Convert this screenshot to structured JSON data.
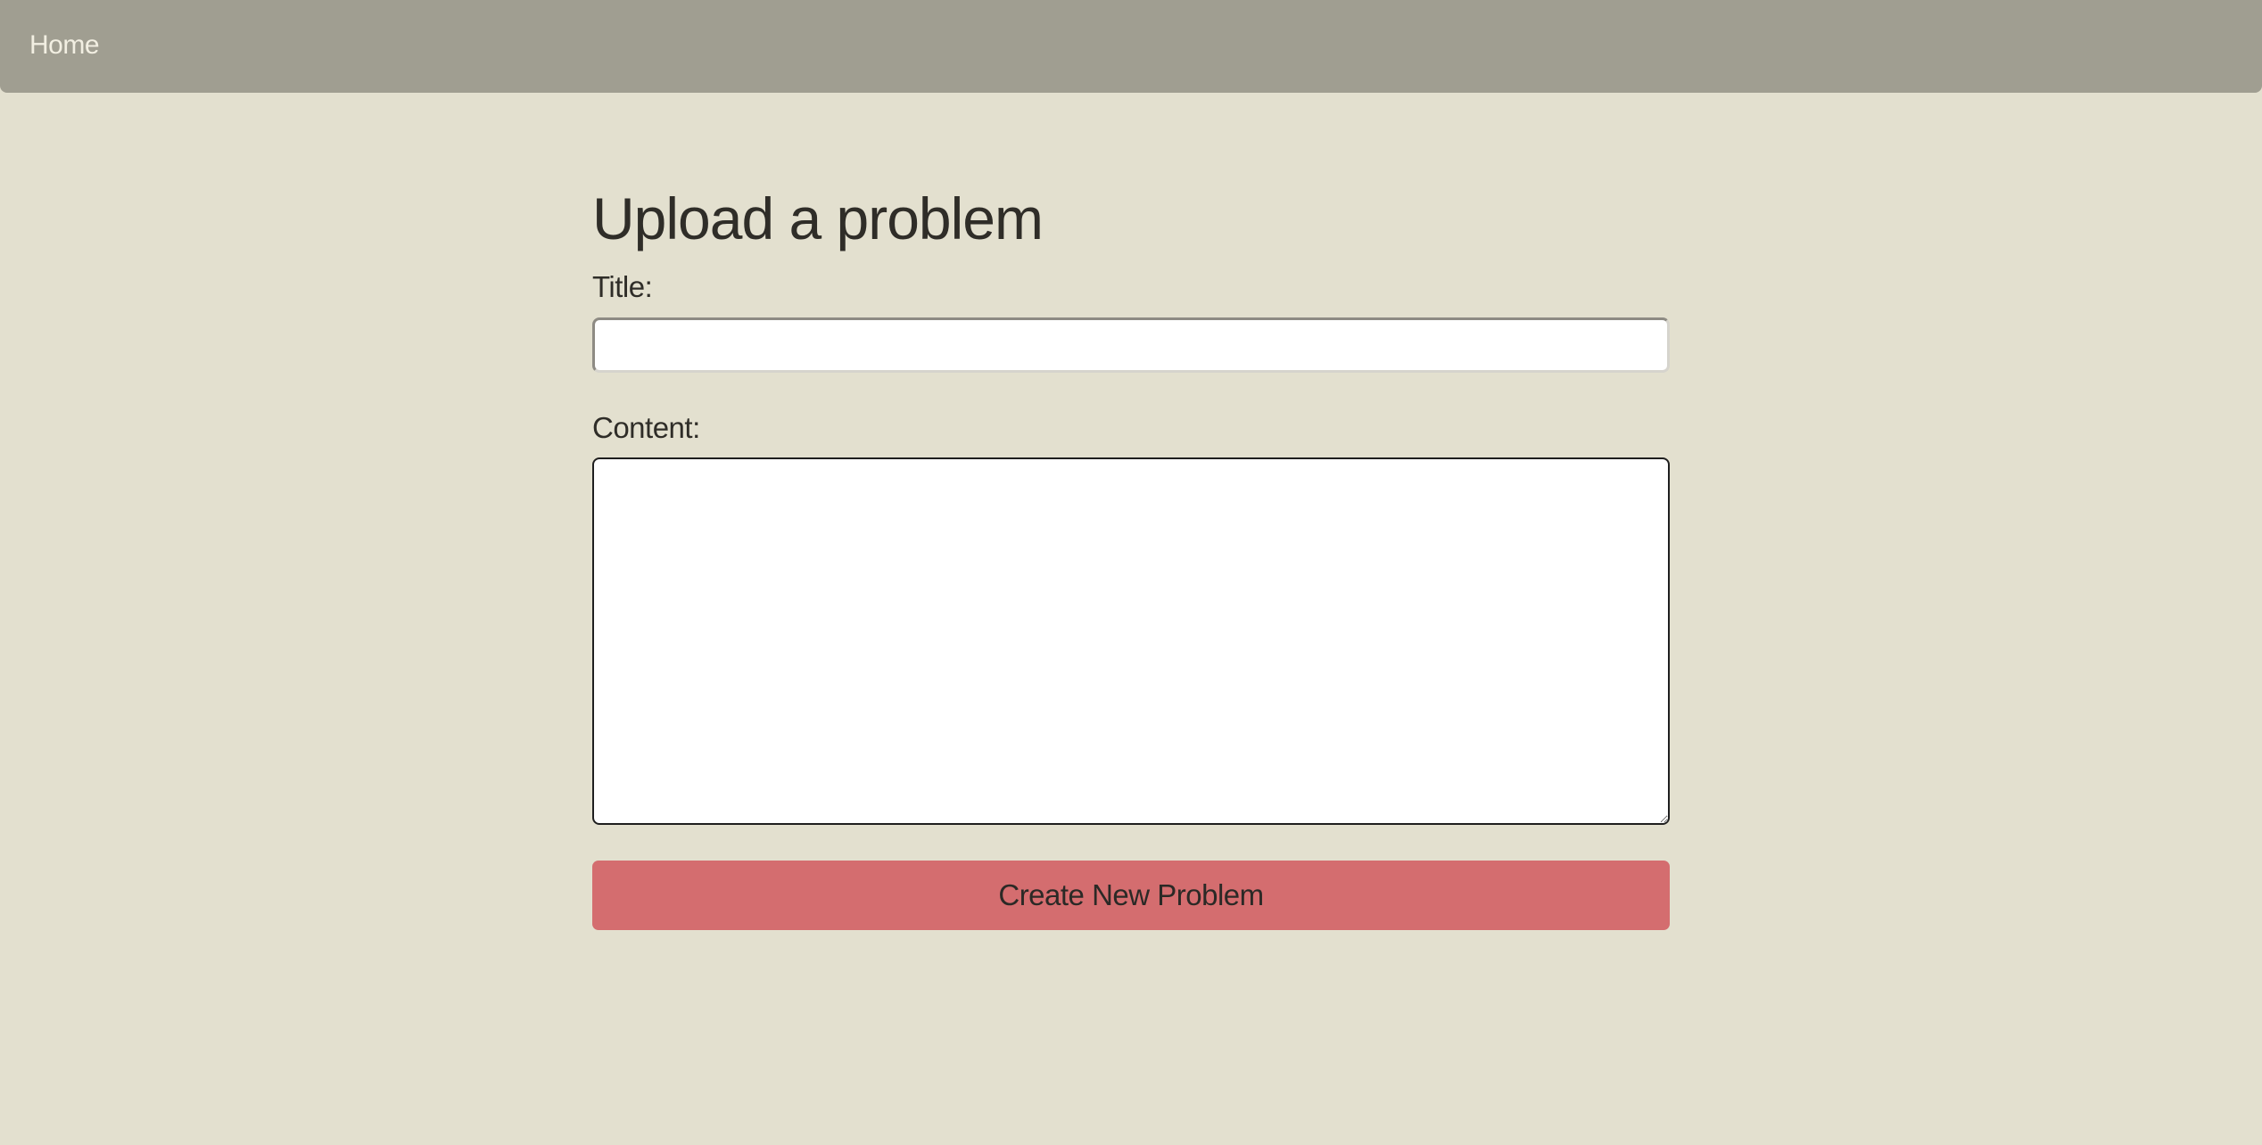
{
  "nav": {
    "home_label": "Home"
  },
  "page": {
    "title": "Upload a problem"
  },
  "form": {
    "title_label": "Title:",
    "title_value": "",
    "content_label": "Content:",
    "content_value": "",
    "submit_label": "Create New Problem"
  },
  "colors": {
    "background": "#e3e0cf",
    "navbar": "#a09e91",
    "submit_button": "#d46d6f"
  }
}
